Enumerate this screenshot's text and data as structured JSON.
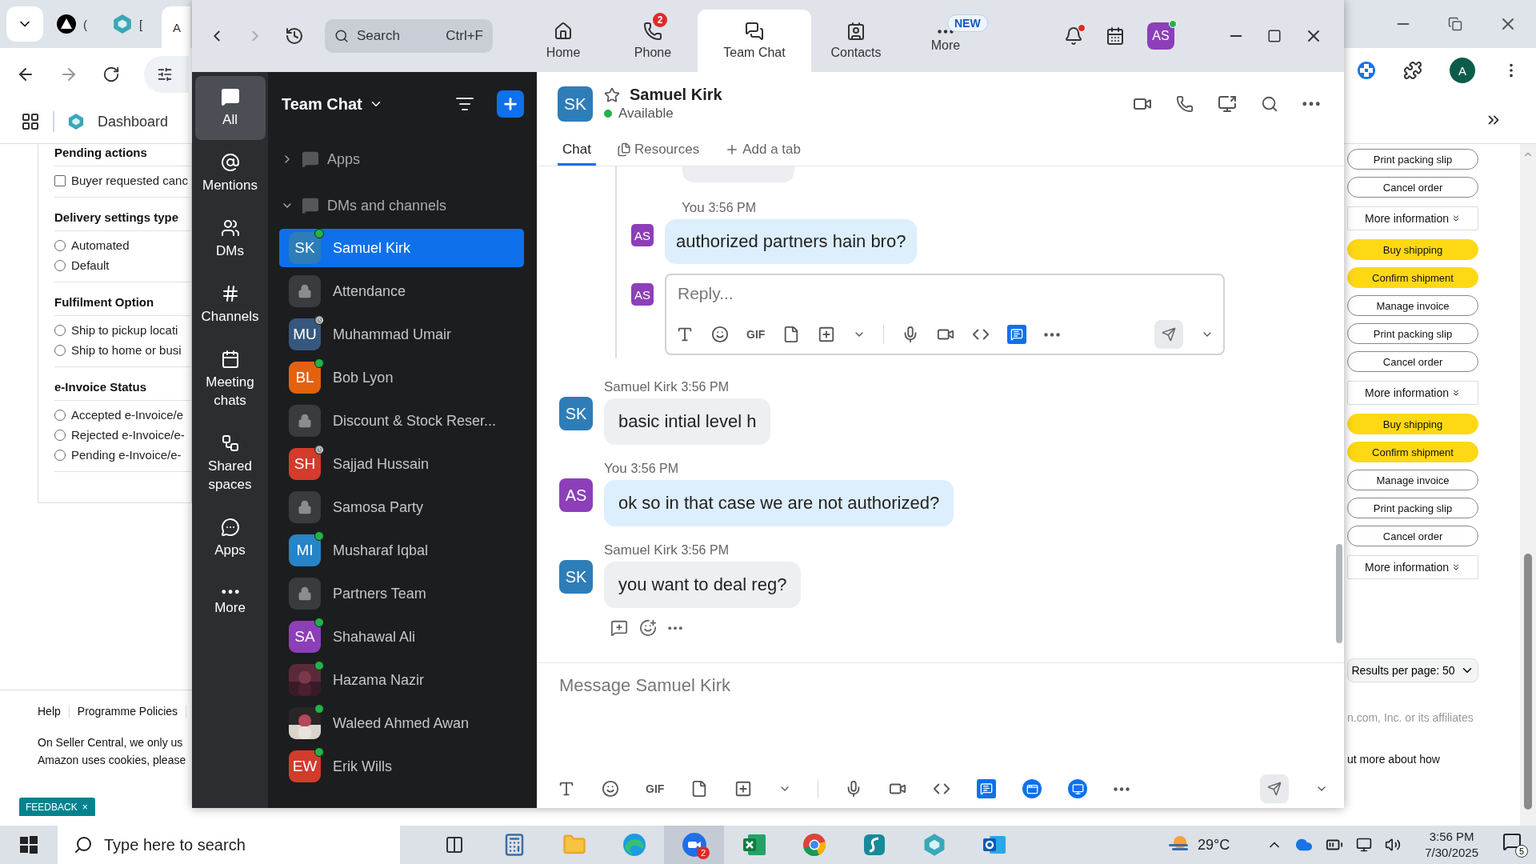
{
  "browser": {
    "tabs": [
      {
        "title": "(",
        "selected": false
      },
      {
        "title": "[",
        "selected": false
      },
      {
        "title": "A",
        "selected": true
      }
    ],
    "bookmark": "Dashboard",
    "profile_initial": "A",
    "filters": [
      {
        "title": "Pending actions",
        "options": [
          {
            "label": "Buyer requested canc",
            "kind": "checkbox",
            "checked": false
          }
        ]
      },
      {
        "title": "Delivery settings type",
        "options": [
          {
            "label": "Automated",
            "kind": "radio",
            "checked": false
          },
          {
            "label": "Default",
            "kind": "radio",
            "checked": false
          }
        ]
      },
      {
        "title": "Fulfilment Option",
        "options": [
          {
            "label": "Ship to pickup locati",
            "kind": "radio",
            "checked": false
          },
          {
            "label": "Ship to home or busi",
            "kind": "radio",
            "checked": false
          }
        ]
      },
      {
        "title": "e-Invoice Status",
        "options": [
          {
            "label": "Accepted e-Invoice/e",
            "kind": "radio",
            "checked": false
          },
          {
            "label": "Rejected e-Invoice/e-",
            "kind": "radio",
            "checked": false
          },
          {
            "label": "Pending e-Invoice/e-",
            "kind": "radio",
            "checked": false
          }
        ]
      }
    ],
    "footer_links": [
      "Help",
      "Programme Policies"
    ],
    "footer_lines": [
      "On Seller Central, we only us",
      "Amazon uses cookies, please"
    ],
    "feedback": {
      "label": "FEEDBACK",
      "close": "×"
    },
    "order_actions": [
      {
        "label": "Print packing slip",
        "kind": "outline"
      },
      {
        "label": "Cancel order",
        "kind": "outline"
      },
      {
        "label": "More information",
        "kind": "more"
      },
      {
        "label": "Buy shipping",
        "kind": "primary"
      },
      {
        "label": "Confirm shipment",
        "kind": "primary"
      },
      {
        "label": "Manage invoice",
        "kind": "outline"
      },
      {
        "label": "Print packing slip",
        "kind": "outline"
      },
      {
        "label": "Cancel order",
        "kind": "outline"
      },
      {
        "label": "More information",
        "kind": "more"
      },
      {
        "label": "Buy shipping",
        "kind": "primary"
      },
      {
        "label": "Confirm shipment",
        "kind": "primary"
      },
      {
        "label": "Manage invoice",
        "kind": "outline"
      },
      {
        "label": "Print packing slip",
        "kind": "outline"
      },
      {
        "label": "Cancel order",
        "kind": "outline"
      },
      {
        "label": "More information",
        "kind": "more"
      }
    ],
    "results_per_page": "Results per page: 50",
    "right_footer_lines": [
      "n.com, Inc. or its affiliates",
      "ut more about how"
    ]
  },
  "zoom": {
    "search": {
      "placeholder": "Search",
      "shortcut": "Ctrl+F"
    },
    "tabs": [
      {
        "label": "Home",
        "selected": false
      },
      {
        "label": "Phone",
        "badge": "2",
        "selected": false
      },
      {
        "label": "Team Chat",
        "selected": true
      },
      {
        "label": "Contacts",
        "selected": false
      },
      {
        "label": "More",
        "tag": "NEW",
        "selected": false
      }
    ],
    "notification_dot": true,
    "user": {
      "initials": "AS",
      "online": true
    },
    "rail": [
      {
        "label": "All",
        "selected": true
      },
      {
        "label": "Mentions",
        "selected": false
      },
      {
        "label": "DMs",
        "selected": false
      },
      {
        "label": "Channels",
        "selected": false
      },
      {
        "label": "Meeting chats",
        "selected": false
      },
      {
        "label": "Shared spaces",
        "selected": false
      },
      {
        "label": "Apps",
        "selected": false
      },
      {
        "label": "More",
        "selected": false
      }
    ],
    "list": {
      "title": "Team Chat",
      "sections": [
        {
          "label": "Apps",
          "expanded": false
        },
        {
          "label": "DMs and channels",
          "expanded": true
        }
      ],
      "items": [
        {
          "name": "Samuel Kirk",
          "kind": "person",
          "initials": "SK",
          "color": "#2d7db8",
          "away": false,
          "selected": true
        },
        {
          "name": "Attendance",
          "kind": "channel",
          "selected": false
        },
        {
          "name": "Muhammad Umair",
          "kind": "person",
          "initials": "MU",
          "color": "#36587e",
          "away": true,
          "selected": false
        },
        {
          "name": "Bob Lyon",
          "kind": "person",
          "initials": "BL",
          "color": "#e2620f",
          "away": false,
          "selected": false
        },
        {
          "name": "Discount & Stock Reser...",
          "kind": "channel",
          "selected": false
        },
        {
          "name": "Sajjad Hussain",
          "kind": "person",
          "initials": "SH",
          "color": "#d33b2c",
          "away": true,
          "selected": false
        },
        {
          "name": "Samosa Party",
          "kind": "channel",
          "selected": false
        },
        {
          "name": "Musharaf Iqbal",
          "kind": "person",
          "initials": "MI",
          "color": "#2784c6",
          "away": false,
          "selected": false
        },
        {
          "name": "Partners Team",
          "kind": "channel",
          "selected": false
        },
        {
          "name": "Shahawal Ali",
          "kind": "person",
          "initials": "SA",
          "color": "#8c3fb8",
          "away": false,
          "selected": false
        },
        {
          "name": "Hazama Nazir",
          "away": false,
          "selected": false
        },
        {
          "name": "Waleed Ahmed Awan",
          "away": false,
          "selected": false
        },
        {
          "name": "Erik Wills",
          "kind": "person",
          "initials": "EW",
          "color": "#d33b2c",
          "away": false,
          "selected": false
        }
      ]
    },
    "chat": {
      "contact": {
        "initials": "SK",
        "name": "Samuel Kirk",
        "status": "Available",
        "starred": false
      },
      "tabs": [
        {
          "label": "Chat",
          "kind": "tab",
          "selected": true
        },
        {
          "label": "Resources",
          "kind": "tab",
          "selected": false
        },
        {
          "label": "Add a tab",
          "kind": "add",
          "selected": false
        }
      ],
      "thread": {
        "sender": "You",
        "time": "3:56 PM",
        "initials": "AS",
        "text": "authorized partners hain bro?",
        "reply_placeholder": "Reply...",
        "reply_initials": "AS",
        "gif_label": "GIF"
      },
      "messages": [
        {
          "sender": "Samuel Kirk",
          "time": "3:56 PM",
          "initials": "SK",
          "mine": false,
          "text": "basic intial level h"
        },
        {
          "sender": "You",
          "time": "3:56 PM",
          "initials": "AS",
          "mine": true,
          "text": "ok so in that case we are not authorized?"
        },
        {
          "sender": "Samuel Kirk",
          "time": "3:56 PM",
          "initials": "SK",
          "mine": false,
          "text": "you want to deal reg?"
        }
      ],
      "composer": {
        "placeholder": "Message Samuel Kirk",
        "gif_label": "GIF"
      }
    }
  },
  "taskbar": {
    "search_placeholder": "Type here to search",
    "apps": [
      {
        "active": false
      },
      {
        "active": false
      },
      {
        "active": false
      },
      {
        "active": false
      },
      {
        "badge": "2",
        "active": true
      },
      {
        "active": false
      },
      {
        "active": false
      },
      {
        "active": false
      },
      {
        "active": false
      },
      {
        "active": false
      }
    ],
    "weather": "29°C",
    "time": "3:56 PM",
    "date": "7/30/2025",
    "notifications": "5"
  }
}
